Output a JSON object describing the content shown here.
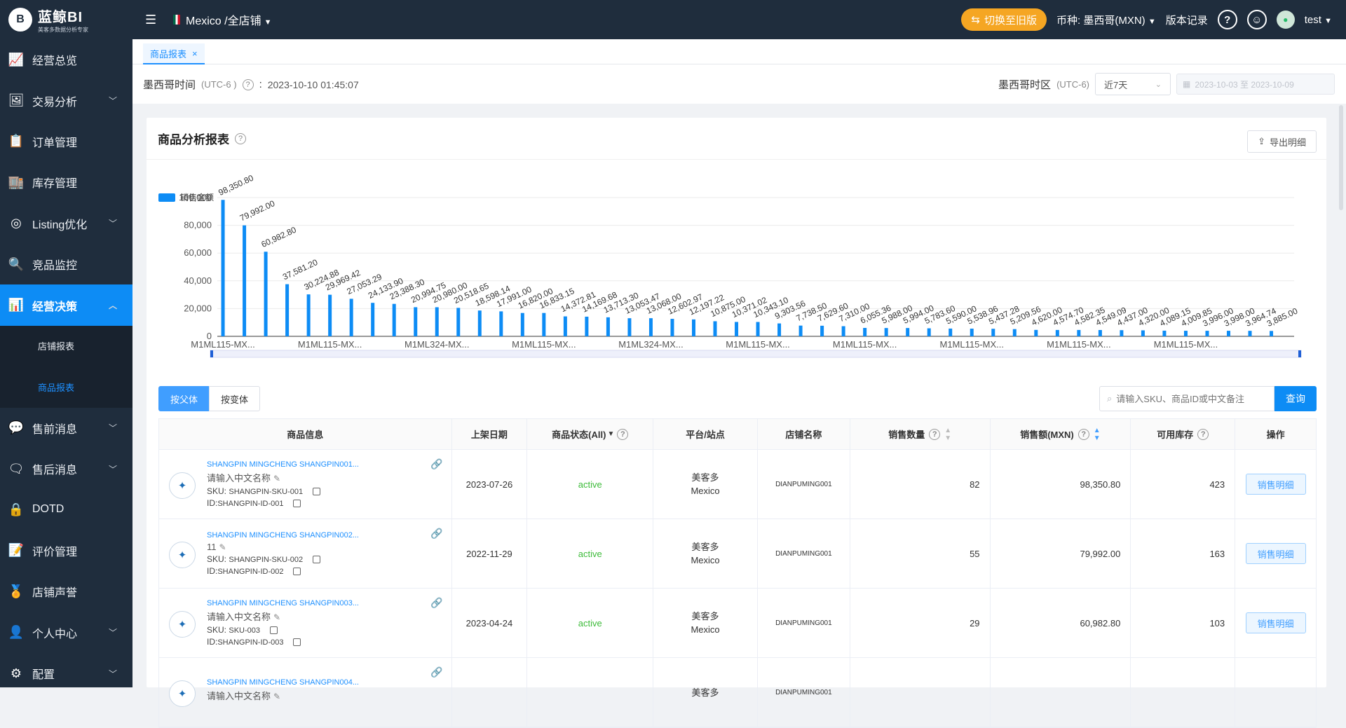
{
  "brand": {
    "title": "蓝鲸BI",
    "subtitle": "美客多数据分析专家",
    "logo_letter": "B"
  },
  "sidebar": {
    "items": [
      {
        "label": "经营总览",
        "icon": "trend-icon",
        "caret": false
      },
      {
        "label": "交易分析",
        "icon": "image-chart-icon",
        "caret": true
      },
      {
        "label": "订单管理",
        "icon": "clipboard-icon",
        "caret": false
      },
      {
        "label": "库存管理",
        "icon": "warehouse-icon",
        "caret": false
      },
      {
        "label": "Listing优化",
        "icon": "target-icon",
        "caret": true
      },
      {
        "label": "竞品监控",
        "icon": "monitor-icon",
        "caret": false
      },
      {
        "label": "经营决策",
        "icon": "decision-icon",
        "caret": true,
        "active": true
      }
    ],
    "sub_items": [
      {
        "label": "店铺报表",
        "active": false
      },
      {
        "label": "商品报表",
        "active": true
      }
    ],
    "items_after": [
      {
        "label": "售前消息",
        "icon": "chat-icon",
        "caret": true
      },
      {
        "label": "售后消息",
        "icon": "chat-bubbles-icon",
        "caret": true
      },
      {
        "label": "DOTD",
        "icon": "lock-icon",
        "caret": false
      },
      {
        "label": "评价管理",
        "icon": "review-icon",
        "caret": false
      },
      {
        "label": "店铺声誉",
        "icon": "badge-icon",
        "caret": false
      },
      {
        "label": "个人中心",
        "icon": "user-icon",
        "caret": true
      },
      {
        "label": "配置",
        "icon": "config-icon",
        "caret": true
      }
    ]
  },
  "topbar": {
    "region": "Mexico /全店铺",
    "switch_old": "切换至旧版",
    "currency_label": "币种:",
    "currency_value": "墨西哥(MXN)",
    "version_log": "版本记录",
    "help": "?",
    "username": "test"
  },
  "tab": {
    "label": "商品报表",
    "close": "×"
  },
  "time": {
    "label": "墨西哥时间",
    "tz": "(UTC-6 )",
    "colon": ":",
    "value": "2023-10-10 01:45:07",
    "zone_label": "墨西哥时区",
    "zone_tz": "(UTC-6)",
    "range_select": "近7天",
    "date_range": "2023-10-03  至  2023-10-09"
  },
  "card": {
    "title": "商品分析报表",
    "export": "导出明细"
  },
  "chart_data": {
    "type": "bar",
    "title": "",
    "legend": [
      "销售金额"
    ],
    "legend_position": "top-left",
    "color": "#0d8cf5",
    "ylim": [
      0,
      100000
    ],
    "yticks": [
      "0",
      "20,000",
      "40,000",
      "60,000",
      "80,000",
      "100,000"
    ],
    "xtick_labels": [
      "M1ML115-MX...",
      "M1ML115-MX...",
      "M1ML324-MX...",
      "M1ML115-MX...",
      "M1ML324-MX...",
      "M1ML115-MX...",
      "M1ML115-MX...",
      "M1ML115-MX...",
      "M1ML115-MX...",
      "M1ML115-MX..."
    ],
    "values": [
      98350.8,
      79992.0,
      60982.8,
      37581.2,
      30224.88,
      29969.42,
      27053.29,
      24133.9,
      23388.3,
      20994.75,
      20980.0,
      20518.65,
      18598.14,
      17991.0,
      16820.0,
      16833.15,
      14372.81,
      14169.68,
      13713.3,
      13053.47,
      13068.0,
      12602.97,
      12197.22,
      10875.0,
      10371.02,
      10343.1,
      9303.56,
      7738.5,
      7629.6,
      7310.0,
      6055.36,
      5988.0,
      5994.0,
      5783.6,
      5590.0,
      5538.96,
      5437.28,
      5209.56,
      4620.0,
      4574.7,
      4582.35,
      4549.09,
      4437.0,
      4320.0,
      4089.15,
      4009.85,
      3996.0,
      3998.0,
      3964.74,
      3885.0
    ],
    "labels": [
      "98,350.80",
      "79,992.00",
      "60,982.80",
      "37,581.20",
      "30,224.88",
      "29,969.42",
      "27,053.29",
      "24,133.90",
      "23,388.30",
      "20,994.75",
      "20,980.00",
      "20,518.65",
      "18,598.14",
      "17,991.00",
      "16,820.00",
      "16,833.15",
      "14,372.81",
      "14,169.68",
      "13,713.30",
      "13,053.47",
      "13,068.00",
      "12,602.97",
      "12,197.22",
      "10,875.00",
      "10,371.02",
      "10,343.10",
      "9,303.56",
      "7,738.50",
      "7,629.60",
      "7,310.00",
      "6,055.36",
      "5,988.00",
      "5,994.00",
      "5,783.60",
      "5,590.00",
      "5,538.96",
      "5,437.28",
      "5,209.56",
      "4,620.00",
      "4,574.70",
      "4,582.35",
      "4,549.09",
      "4,437.00",
      "4,320.00",
      "4,089.15",
      "4,009.85",
      "3,996.00",
      "3,998.00",
      "3,964.74",
      "3,885.00"
    ],
    "grid": true
  },
  "tools": {
    "by_parent": "按父体",
    "by_variant": "按变体",
    "search_placeholder": "请输入SKU、商品ID或中文备注",
    "search_btn": "查询"
  },
  "table": {
    "headers": [
      "商品信息",
      "上架日期",
      "商品状态(All)",
      "平台/站点",
      "店铺名称",
      "销售数量",
      "销售额(MXN)",
      "可用库存",
      "操作"
    ],
    "rows": [
      {
        "name": "SHANGPIN MINGCHENG SHANGPIN001...",
        "cn": "请输入中文名称",
        "sku_label": "SKU:",
        "sku": "SHANGPIN-SKU-001",
        "id_label": "ID:",
        "id": "SHANGPIN-ID-001",
        "date": "2023-07-26",
        "status": "active",
        "platform": "美客多",
        "site": "Mexico",
        "shop": "DIANPUMING001",
        "qty": "82",
        "sales": "98,350.80",
        "stock": "423",
        "action": "销售明细"
      },
      {
        "name": "SHANGPIN MINGCHENG SHANGPIN002...",
        "cn": "11",
        "sku_label": "SKU:",
        "sku": "SHANGPIN-SKU-002",
        "id_label": "ID:",
        "id": "SHANGPIN-ID-002",
        "date": "2022-11-29",
        "status": "active",
        "platform": "美客多",
        "site": "Mexico",
        "shop": "DIANPUMING001",
        "qty": "55",
        "sales": "79,992.00",
        "stock": "163",
        "action": "销售明细"
      },
      {
        "name": "SHANGPIN MINGCHENG SHANGPIN003...",
        "cn": "请输入中文名称",
        "sku_label": "SKU:",
        "sku": "SKU-003",
        "id_label": "ID:",
        "id": "SHANGPIN-ID-003",
        "date": "2023-04-24",
        "status": "active",
        "platform": "美客多",
        "site": "Mexico",
        "shop": "DIANPUMING001",
        "qty": "29",
        "sales": "60,982.80",
        "stock": "103",
        "action": "销售明细"
      },
      {
        "name": "SHANGPIN MINGCHENG SHANGPIN004...",
        "cn": "请输入中文名称",
        "sku_label": "",
        "sku": "",
        "id_label": "",
        "id": "",
        "date": "",
        "status": "",
        "platform": "美客多",
        "site": "",
        "shop": "DIANPUMING001",
        "qty": "",
        "sales": "",
        "stock": "",
        "action": ""
      }
    ]
  }
}
